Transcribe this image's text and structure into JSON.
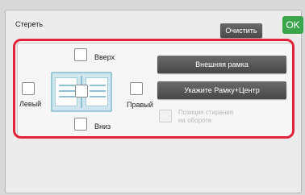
{
  "header": {
    "title": "Стереть",
    "clear_label": "Очистить",
    "ok_label": "OK"
  },
  "edges": {
    "top_label": "Вверх",
    "left_label": "Левый",
    "right_label": "Правый",
    "bottom_label": "Вниз"
  },
  "actions": {
    "outer_frame_label": "Внешняя рамка",
    "frame_center_label": "Укажите Рамку+Центр",
    "back_side_label_line1": "Позиция стирания",
    "back_side_label_line2": "на обороте"
  },
  "colors": {
    "ok": "#3aa54b",
    "highlight": "#e0243b"
  }
}
